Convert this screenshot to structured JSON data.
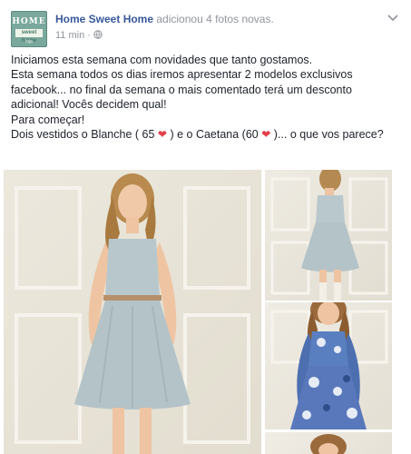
{
  "post": {
    "avatar": {
      "line1": "HOME",
      "line2": "sweet home",
      "line3": "loja"
    },
    "page_name": "Home Sweet Home",
    "action": "adicionou 4 fotos novas.",
    "timestamp": "11 min",
    "separator": "·",
    "privacy_icon": "globe-icon",
    "text": {
      "line1": "Iniciamos esta semana com novidades que tanto gostamos.",
      "line2": "Esta semana todos os dias iremos apresentar 2 modelos exclusivos facebook... no final da semana o mais comentado terá um desconto adicional! Vocês decidem qual!",
      "line3": "Para começar!",
      "line4_a": "Dois vestidos o Blanche ( 65",
      "line4_b": ") e o Caetana (60",
      "line4_c": ")... o que vos parece?"
    },
    "photos_count": 4
  },
  "colors": {
    "link": "#365899",
    "meta": "#90949c",
    "heart": "#e0404a"
  }
}
